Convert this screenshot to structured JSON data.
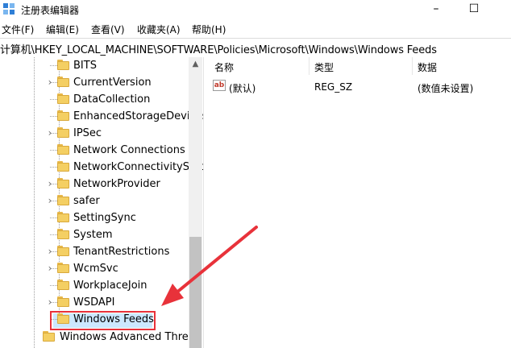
{
  "window": {
    "title": "注册表编辑器",
    "minimize_glyph": "–",
    "maximize_glyph": "☐"
  },
  "menu": [
    "文件(F)",
    "编辑(E)",
    "查看(V)",
    "收藏夹(A)",
    "帮助(H)"
  ],
  "address": "计算机\\HKEY_LOCAL_MACHINE\\SOFTWARE\\Policies\\Microsoft\\Windows\\Windows Feeds",
  "tree": {
    "items": [
      {
        "label": "BITS",
        "expandable": false
      },
      {
        "label": "CurrentVersion",
        "expandable": true
      },
      {
        "label": "DataCollection",
        "expandable": false
      },
      {
        "label": "EnhancedStorageDevices",
        "expandable": false
      },
      {
        "label": "IPSec",
        "expandable": true
      },
      {
        "label": "Network Connections",
        "expandable": false
      },
      {
        "label": "NetworkConnectivityStatusIndicator",
        "expandable": false
      },
      {
        "label": "NetworkProvider",
        "expandable": true
      },
      {
        "label": "safer",
        "expandable": true
      },
      {
        "label": "SettingSync",
        "expandable": false
      },
      {
        "label": "System",
        "expandable": false
      },
      {
        "label": "TenantRestrictions",
        "expandable": true
      },
      {
        "label": "WcmSvc",
        "expandable": true
      },
      {
        "label": "WorkplaceJoin",
        "expandable": false
      },
      {
        "label": "WSDAPI",
        "expandable": true
      }
    ],
    "selected": "Windows Feeds",
    "bottom_item": "Windows Advanced Threat Protection"
  },
  "list": {
    "columns": {
      "name": "名称",
      "type": "类型",
      "data": "数据"
    },
    "rows": [
      {
        "icon": "ab",
        "name": "(默认)",
        "type": "REG_SZ",
        "data": "(数值未设置)"
      }
    ]
  },
  "colors": {
    "selection_fill": "#cce8ff",
    "highlight_box": "#e8323a",
    "folder": "#f4cf63"
  }
}
